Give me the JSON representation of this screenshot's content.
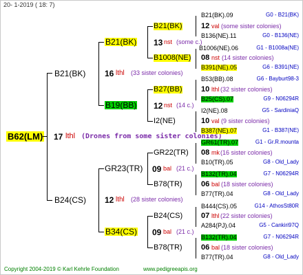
{
  "header_date": "20-  1-2019 (  18:  7)",
  "footer": {
    "copyright": "Copyright 2004-2019 © Karl Kehrle Foundation",
    "url": "www.pedigreeapis.org"
  },
  "root": {
    "name": "B62(LM)",
    "num": "17",
    "label": "lthl",
    "note": "(Drones from some sister colonies)"
  },
  "gen1": {
    "top": {
      "name": "B21(BK)",
      "num": "16",
      "label": "lthl",
      "note": "(33 sister colonies)"
    },
    "bottom": {
      "name": "B24(CS)",
      "num": "12",
      "label": "lthl",
      "note": "(28 sister colonies)"
    }
  },
  "gen2": {
    "a": {
      "name": "B21(BK)",
      "num": "13",
      "label": "nst",
      "note": "(some c.)"
    },
    "b": {
      "name": "B19(BB)",
      "num": "12",
      "label": "nst",
      "note": "(14 c.)"
    },
    "c": {
      "name": "GR23(TR)",
      "num": "09",
      "label": "bal",
      "note": "(21 c.)"
    },
    "d": {
      "name": "B34(CS)",
      "num": "09",
      "label": "bal",
      "note": "(21 c.)"
    }
  },
  "gen3": {
    "a1": "B21(BK)",
    "a2": "B1008(NE)",
    "b1": "B27(BB)",
    "b2": "I2(NE)",
    "c1": "GR22(TR)",
    "c2": "B78(TR)",
    "d1": "B24(CS)",
    "d2": "B78(TR)"
  },
  "gen3notes": [
    {
      "num": "12",
      "label": "val",
      "note": "(some sister colonies)"
    },
    {
      "num": "08",
      "label": "nst",
      "note": "(14 sister colonies)"
    },
    {
      "num": "10",
      "label": "lthl",
      "note": "(32 sister colonies)"
    },
    {
      "num": "10",
      "label": "val",
      "note": "(9 sister colonies)"
    },
    {
      "num": "08",
      "label": "mk",
      "note": "(16 sister colonies)"
    },
    {
      "num": "06",
      "label": "bal",
      "note": "(18 sister colonies)"
    },
    {
      "num": "07",
      "label": "lthl",
      "note": "(22 sister colonies)"
    },
    {
      "num": "06",
      "label": "bal",
      "note": "(18 sister colonies)"
    }
  ],
  "gen4": [
    {
      "name": "B21(BK).09",
      "ref": "G0 - B21(BK)"
    },
    {
      "name": "B136(NE).11",
      "ref": "G0 - B136(NE)"
    },
    {
      "name": "B1006(NE).06",
      "ref": "G1 - B1008a(NE)"
    },
    {
      "name": "B391(NE).05",
      "ref": "G6 - B391(NE)"
    },
    {
      "name": "B53(BB).08",
      "ref": "G6 - Bayburt98-3"
    },
    {
      "name": "B25(CS).07",
      "ref": "G9 - N06294R"
    },
    {
      "name": "I2(NE).08",
      "ref": "G5 - SardiniaQ"
    },
    {
      "name": "B387(NE).07",
      "ref": "G1 - B387(NE)"
    },
    {
      "name": "GR61(TR).07",
      "ref": "G1 - Gr.R.mounta"
    },
    {
      "name": "B10(TR).05",
      "ref": "G8 - Old_Lady"
    },
    {
      "name": "B132(TR).04",
      "ref": "G7 - N06294R"
    },
    {
      "name": "B77(TR).04",
      "ref": "G8 - Old_Lady"
    },
    {
      "name": "B444(CS).05",
      "ref": "G14 - AthosSt80R"
    },
    {
      "name": "A284(PJ).04",
      "ref": "G5 - Cankiri97Q"
    },
    {
      "name": "B132(TR).04",
      "ref": "G7 - N06294R"
    },
    {
      "name": "B77(TR).04",
      "ref": "G8 - Old_Lady"
    }
  ]
}
